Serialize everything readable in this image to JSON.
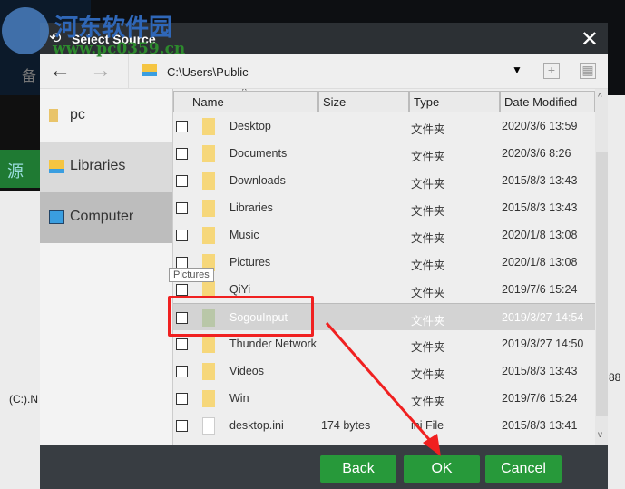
{
  "watermark": {
    "name": "河东软件园",
    "url": "www.pc0359.cn"
  },
  "background": {
    "menu_char": "备",
    "green_label": "源",
    "drive_text": "(C:).N",
    "right_number": "88"
  },
  "dialog": {
    "title": "Select Source",
    "path": "C:\\Users\\Public",
    "sidebar": [
      {
        "label": "pc"
      },
      {
        "label": "Libraries"
      },
      {
        "label": "Computer"
      }
    ],
    "columns": [
      "Name",
      "Size",
      "Type",
      "Date Modified"
    ],
    "rows": [
      {
        "name": "Desktop",
        "size": "",
        "type": "文件夹",
        "date": "2020/3/6 13:59",
        "checked": false
      },
      {
        "name": "Documents",
        "size": "",
        "type": "文件夹",
        "date": "2020/3/6 8:26",
        "checked": false
      },
      {
        "name": "Downloads",
        "size": "",
        "type": "文件夹",
        "date": "2015/8/3 13:43",
        "checked": false
      },
      {
        "name": "Libraries",
        "size": "",
        "type": "文件夹",
        "date": "2015/8/3 13:43",
        "checked": false
      },
      {
        "name": "Music",
        "size": "",
        "type": "文件夹",
        "date": "2020/1/8 13:08",
        "checked": false
      },
      {
        "name": "Pictures",
        "size": "",
        "type": "文件夹",
        "date": "2020/1/8 13:08",
        "checked": false
      },
      {
        "name": "QiYi",
        "size": "",
        "type": "文件夹",
        "date": "2019/7/6 15:24",
        "checked": false
      },
      {
        "name": "SogouInput",
        "size": "",
        "type": "文件夹",
        "date": "2019/3/27 14:54",
        "checked": true
      },
      {
        "name": "Thunder Network",
        "size": "",
        "type": "文件夹",
        "date": "2019/3/27 14:50",
        "checked": false
      },
      {
        "name": "Videos",
        "size": "",
        "type": "文件夹",
        "date": "2015/8/3 13:43",
        "checked": false
      },
      {
        "name": "Win",
        "size": "",
        "type": "文件夹",
        "date": "2019/7/6 15:24",
        "checked": false
      },
      {
        "name": "desktop.ini",
        "size": "174 bytes",
        "type": "ini File",
        "date": "2015/8/3 13:41",
        "checked": false
      }
    ],
    "tooltip": "Pictures",
    "buttons": {
      "back": "Back",
      "ok": "OK",
      "cancel": "Cancel"
    }
  },
  "colors": {
    "button": "#27993a",
    "annotation": "#f02020"
  }
}
